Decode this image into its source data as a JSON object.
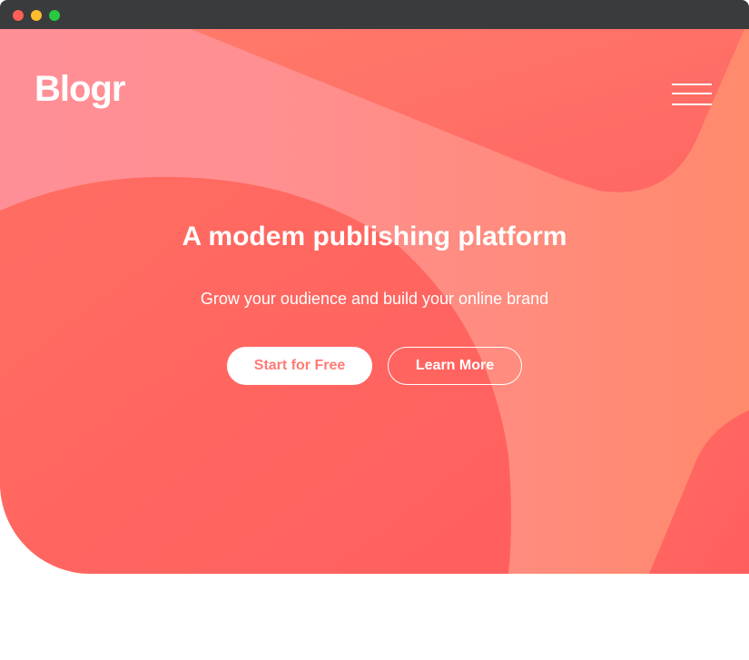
{
  "window": {
    "controls": [
      "close",
      "minimize",
      "maximize"
    ]
  },
  "header": {
    "logo": "Blogr",
    "menu_icon": "hamburger-menu-icon"
  },
  "hero": {
    "title": "A modem publishing platform",
    "subtitle": "Grow your oudience and build your online brand",
    "primary_cta": "Start for Free",
    "secondary_cta": "Learn More"
  },
  "colors": {
    "accent": "#ff7b75",
    "hero_light": "#ff8f97",
    "hero_dark": "#ff6360",
    "titlebar": "#3a3b3d"
  }
}
